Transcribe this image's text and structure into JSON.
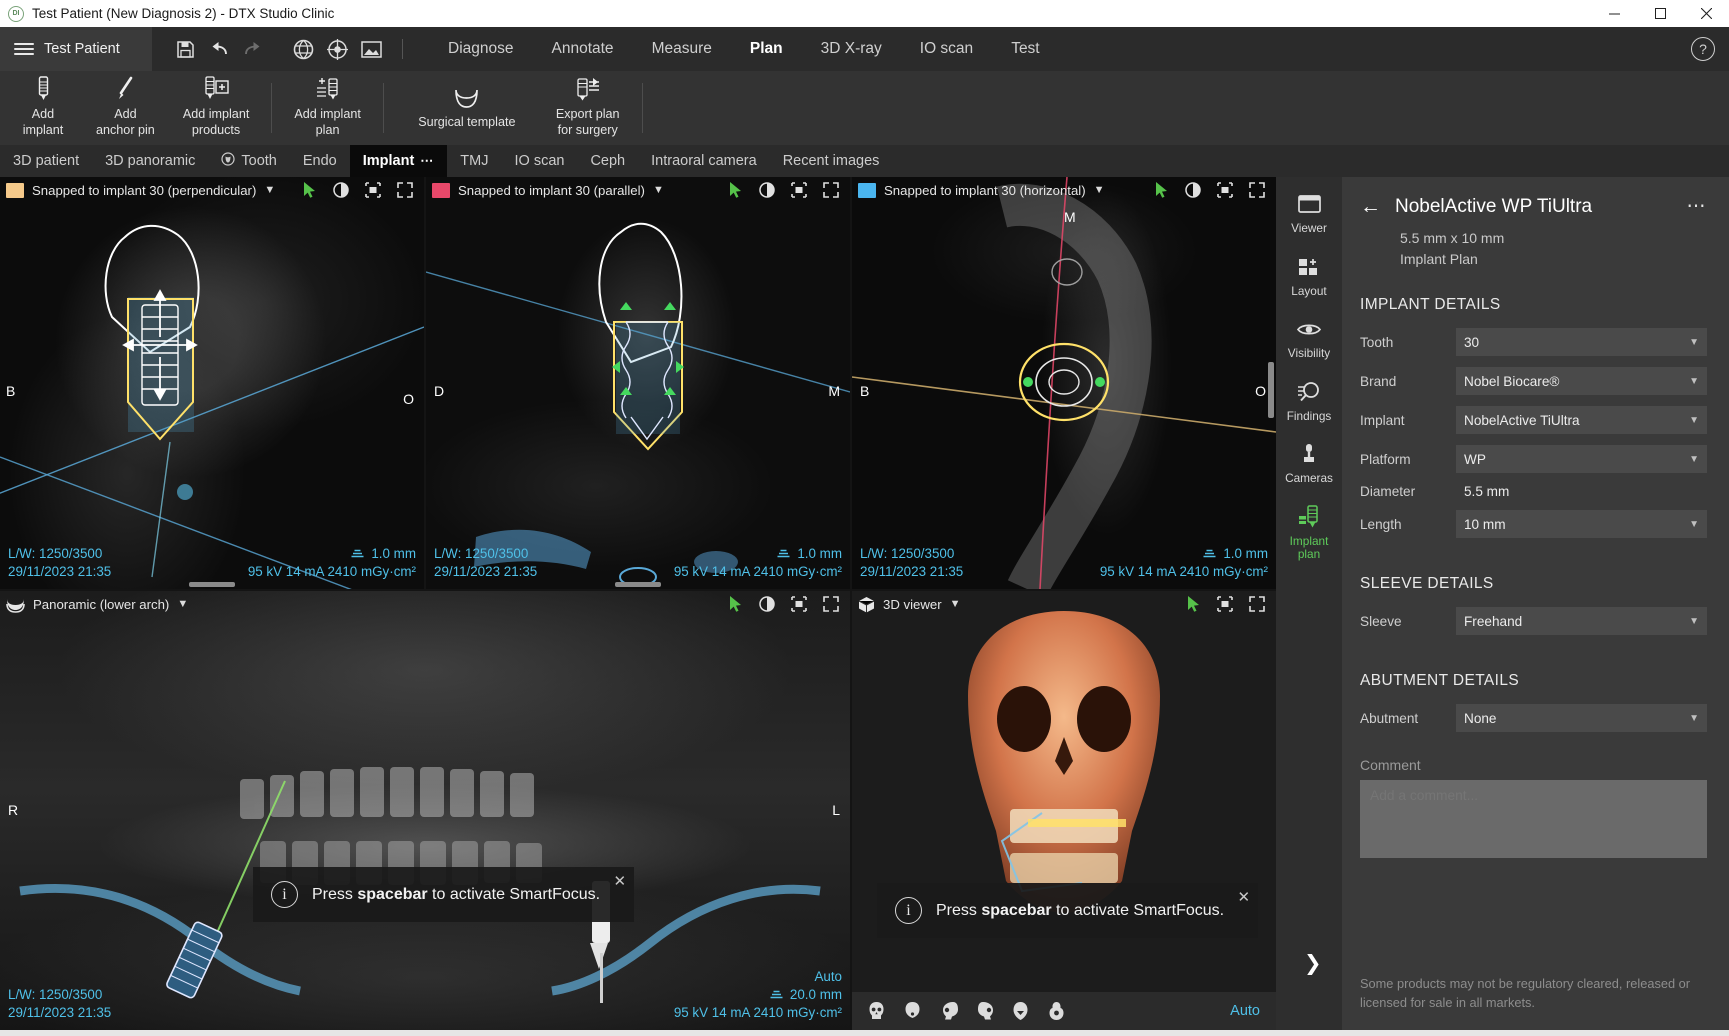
{
  "window": {
    "title": "Test Patient (New Diagnosis 2) - DTX Studio Clinic",
    "app_icon": "dtx-logo-icon",
    "minimize": "minimize-icon",
    "maximize": "maximize-icon",
    "close": "close-icon"
  },
  "menubar": {
    "patient_label": "Test Patient",
    "icons": [
      "save-icon",
      "undo-icon",
      "redo-icon",
      "implant-planning-icon",
      "target-icon",
      "image-icon"
    ],
    "tabs": [
      {
        "label": "Diagnose",
        "active": false
      },
      {
        "label": "Annotate",
        "active": false
      },
      {
        "label": "Measure",
        "active": false
      },
      {
        "label": "Plan",
        "active": true
      },
      {
        "label": "3D X-ray",
        "active": false
      },
      {
        "label": "IO scan",
        "active": false
      },
      {
        "label": "Test",
        "active": false
      }
    ],
    "help": "?"
  },
  "ribbon": {
    "buttons": [
      {
        "label": "Add\nimplant",
        "icon": "implant-icon"
      },
      {
        "label": "Add\nanchor pin",
        "icon": "anchor-pin-icon"
      },
      {
        "label": "Add implant\nproducts",
        "icon": "implant-products-icon"
      },
      {
        "label": "Add implant\nplan",
        "icon": "implant-plan-add-icon"
      },
      {
        "label": "Surgical template",
        "icon": "surgical-template-icon"
      },
      {
        "label": "Export plan\nfor surgery",
        "icon": "export-plan-icon"
      }
    ]
  },
  "module_tabs": [
    {
      "label": "3D patient",
      "active": false,
      "icon": null
    },
    {
      "label": "3D panoramic",
      "active": false,
      "icon": null
    },
    {
      "label": "Tooth",
      "active": false,
      "icon": "tooth-icon"
    },
    {
      "label": "Endo",
      "active": false,
      "icon": null
    },
    {
      "label": "Implant",
      "active": true,
      "icon": null,
      "overflow": "⋯"
    },
    {
      "label": "TMJ",
      "active": false,
      "icon": null
    },
    {
      "label": "IO scan",
      "active": false,
      "icon": null
    },
    {
      "label": "Ceph",
      "active": false,
      "icon": null
    },
    {
      "label": "Intraoral camera",
      "active": false,
      "icon": null
    },
    {
      "label": "Recent images",
      "active": false,
      "icon": null
    }
  ],
  "viewports": [
    {
      "id": "perpendicular",
      "title": "Snapped to implant 30 (perpendicular)",
      "swatch_color": "#f5c98a",
      "orientations": {
        "left": "B",
        "right": "O"
      },
      "overlay_left": [
        "L/W: 1250/3500",
        "29/11/2023 21:35"
      ],
      "overlay_right_thickness": "1.0 mm",
      "overlay_right_exposure": "95 kV  14 mA  2410 mGy·cm²",
      "tools": [
        "cursor-icon",
        "contrast-icon",
        "crop-icon",
        "fullscreen-icon"
      ]
    },
    {
      "id": "parallel",
      "title": "Snapped to implant 30 (parallel)",
      "swatch_color": "#e8486a",
      "orientations": {
        "left": "D",
        "right": "M"
      },
      "overlay_left": [
        "L/W: 1250/3500",
        "29/11/2023 21:35"
      ],
      "overlay_right_thickness": "1.0 mm",
      "overlay_right_exposure": "95 kV  14 mA  2410 mGy·cm²",
      "tools": [
        "cursor-icon",
        "contrast-icon",
        "crop-icon",
        "fullscreen-icon"
      ]
    },
    {
      "id": "horizontal",
      "title": "Snapped to implant 30 (horizontal)",
      "swatch_color": "#4ab5ef",
      "orientations": {
        "left": "B",
        "right": "O",
        "top": "M"
      },
      "overlay_left": [
        "L/W: 1250/3500",
        "29/11/2023 21:35"
      ],
      "overlay_right_thickness": "1.0 mm",
      "overlay_right_exposure": "95 kV  14 mA  2410 mGy·cm²",
      "tools": [
        "cursor-icon",
        "contrast-icon",
        "crop-icon",
        "fullscreen-icon"
      ]
    }
  ],
  "panoramic": {
    "title": "Panoramic (lower arch)",
    "icon": "arch-icon",
    "orientations": {
      "left": "R",
      "right": "L"
    },
    "overlay_left": [
      "L/W: 1250/3500",
      "29/11/2023 21:35"
    ],
    "auto_label": "Auto",
    "thickness": "20.0 mm",
    "exposure": "95 kV  14 mA  2410 mGy·cm²",
    "tools": [
      "cursor-icon",
      "contrast-icon",
      "crop-icon",
      "fullscreen-icon"
    ]
  },
  "viewer3d": {
    "title": "3D viewer",
    "icon": "cube-icon",
    "tools": [
      "cursor-icon",
      "crop-icon",
      "fullscreen-icon"
    ],
    "presets": [
      "skull-front-icon",
      "skull-smooth-icon",
      "skull-left-icon",
      "skull-right-icon",
      "skull-top-icon",
      "skull-bone-icon"
    ],
    "auto_label": "Auto"
  },
  "toast": {
    "text_before": "Press ",
    "text_bold": "spacebar",
    "text_after": " to activate SmartFocus.",
    "info_icon": "info-icon",
    "close_icon": "close-icon"
  },
  "rail": [
    {
      "label": "Viewer",
      "icon": "viewer-icon",
      "active": false
    },
    {
      "label": "Layout",
      "icon": "layout-icon",
      "active": false
    },
    {
      "label": "Visibility",
      "icon": "eye-icon",
      "active": false
    },
    {
      "label": "Findings",
      "icon": "findings-search-icon",
      "active": false
    },
    {
      "label": "Cameras",
      "icon": "camera-icon",
      "active": false
    },
    {
      "label": "Implant\nplan",
      "icon": "implant-plan-icon",
      "active": true
    }
  ],
  "panel": {
    "back_icon": "back-arrow-icon",
    "title": "NobelActive WP TiUltra",
    "more_icon": "more-options-icon",
    "subtitle_line1": "5.5 mm x 10 mm",
    "subtitle_line2": "Implant Plan",
    "implant_details_heading": "IMPLANT DETAILS",
    "fields": [
      {
        "label": "Tooth",
        "value": "30",
        "type": "select"
      },
      {
        "label": "Brand",
        "value": "Nobel Biocare®",
        "type": "select"
      },
      {
        "label": "Implant",
        "value": "NobelActive TiUltra",
        "type": "select"
      },
      {
        "label": "Platform",
        "value": "WP",
        "type": "select"
      },
      {
        "label": "Diameter",
        "value": "5.5 mm",
        "type": "static"
      },
      {
        "label": "Length",
        "value": "10 mm",
        "type": "select"
      }
    ],
    "sleeve_heading": "SLEEVE DETAILS",
    "sleeve_fields": [
      {
        "label": "Sleeve",
        "value": "Freehand",
        "type": "select"
      }
    ],
    "abutment_heading": "ABUTMENT DETAILS",
    "abutment_fields": [
      {
        "label": "Abutment",
        "value": "None",
        "type": "select"
      }
    ],
    "comment_label": "Comment",
    "comment_placeholder": "Add a comment...",
    "comment_value": "",
    "disclaimer": "Some products may not be regulatory cleared, released or licensed for sale in all markets.",
    "collapse_icon": "chevron-right-icon"
  }
}
